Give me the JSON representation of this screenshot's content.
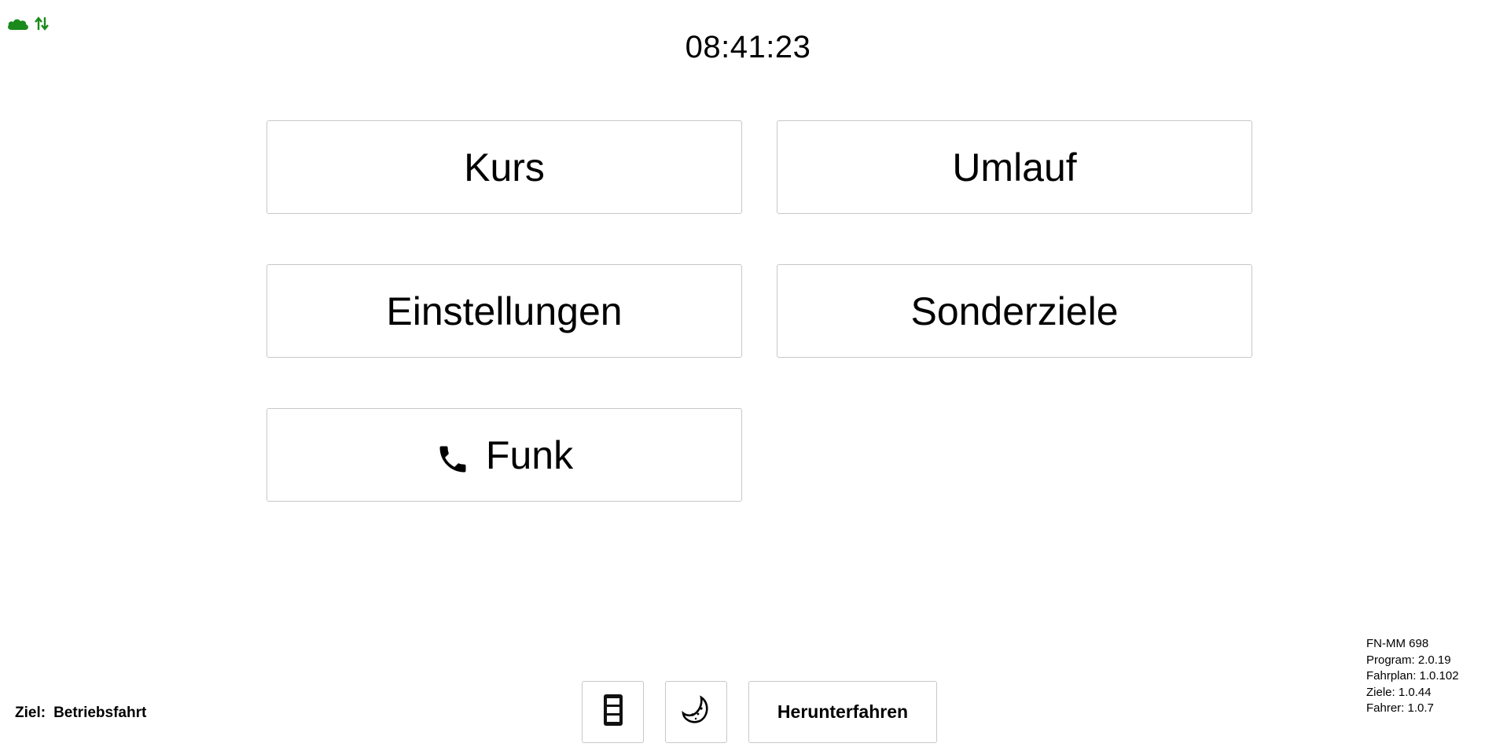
{
  "status": {
    "cloud_icon": "cloud-icon",
    "sync_icon": "sync-arrows-icon",
    "status_color": "#1a8a1a"
  },
  "clock": "08:41:23",
  "menu": {
    "kurs": "Kurs",
    "umlauf": "Umlauf",
    "einstellungen": "Einstellungen",
    "sonderziele": "Sonderziele",
    "funk": "Funk",
    "funk_icon": "phone-icon"
  },
  "footer": {
    "ziel_label": "Ziel:",
    "ziel_value": "Betriebsfahrt",
    "display_icon": "display-panel-icon",
    "night_icon": "moon-icon",
    "shutdown_label": "Herunterfahren"
  },
  "info": {
    "vehicle": "FN-MM 698",
    "program": "Program: 2.0.19",
    "fahrplan": "Fahrplan: 1.0.102",
    "ziele": "Ziele: 1.0.44",
    "fahrer": "Fahrer: 1.0.7"
  }
}
